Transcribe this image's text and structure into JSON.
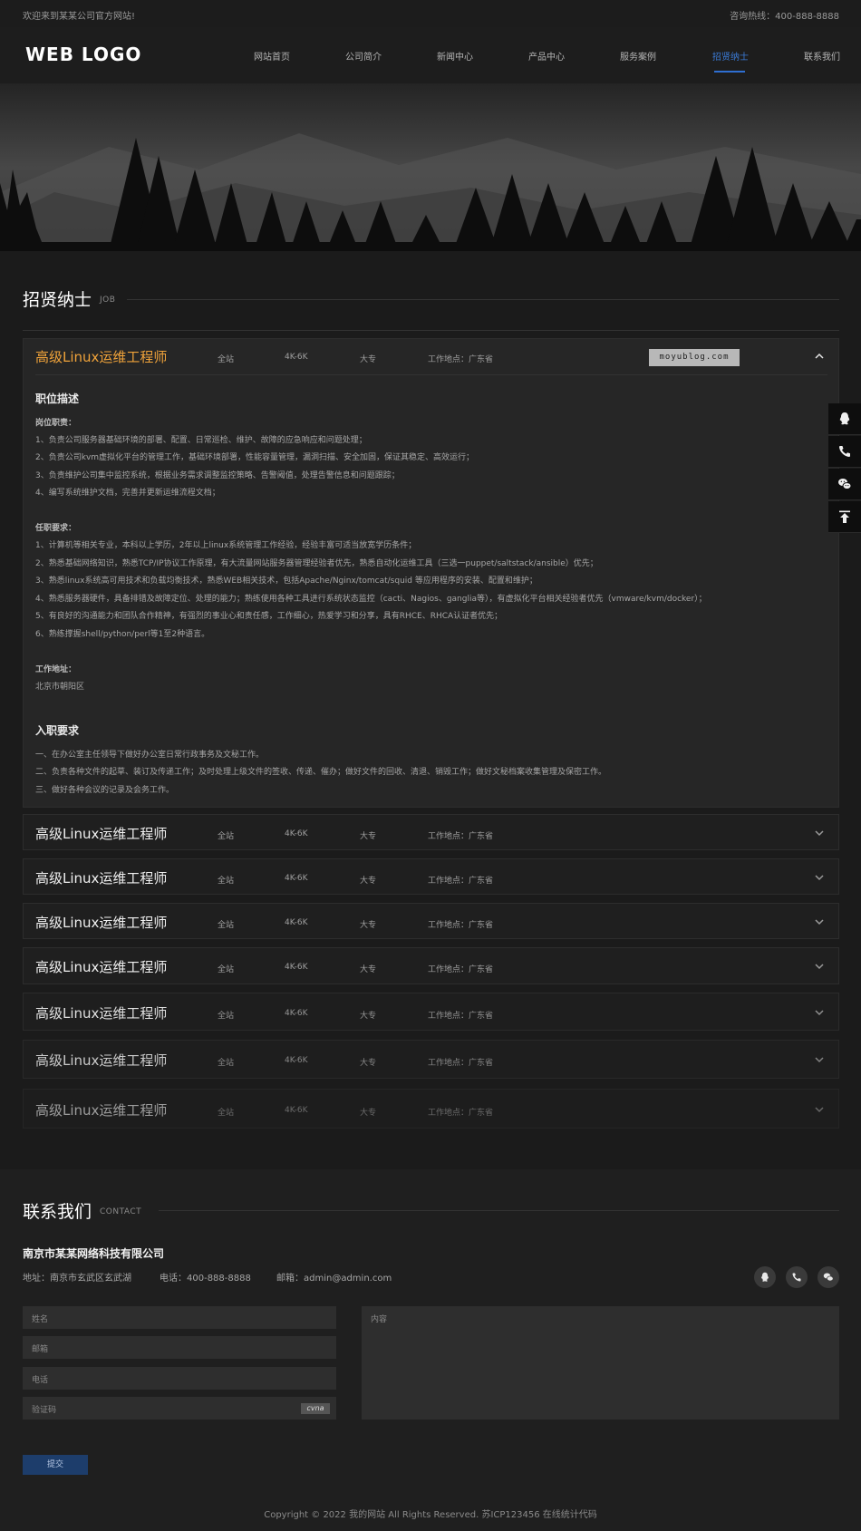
{
  "topbar": {
    "welcome": "欢迎来到某某公司官方网站!",
    "hotline": "咨询热线：400-888-8888"
  },
  "header": {
    "logo": "WEB LOGO",
    "nav": [
      {
        "label": "网站首页"
      },
      {
        "label": "公司简介"
      },
      {
        "label": "新闻中心"
      },
      {
        "label": "产品中心"
      },
      {
        "label": "服务案例"
      },
      {
        "label": "招贤纳士",
        "active": true
      },
      {
        "label": "联系我们"
      }
    ]
  },
  "jobs_section": {
    "title": "招贤纳士",
    "subtitle": "JOB"
  },
  "jobs": [
    {
      "name": "高级Linux运维工程师",
      "type": "全站",
      "salary": "4K-6K",
      "education": "大专",
      "location": "工作地点：广东省",
      "expanded": true
    },
    {
      "name": "高级Linux运维工程师",
      "type": "全站",
      "salary": "4K-6K",
      "education": "大专",
      "location": "工作地点：广东省"
    },
    {
      "name": "高级Linux运维工程师",
      "type": "全站",
      "salary": "4K-6K",
      "education": "大专",
      "location": "工作地点：广东省"
    },
    {
      "name": "高级Linux运维工程师",
      "type": "全站",
      "salary": "4K-6K",
      "education": "大专",
      "location": "工作地点：广东省"
    },
    {
      "name": "高级Linux运维工程师",
      "type": "全站",
      "salary": "4K-6K",
      "education": "大专",
      "location": "工作地点：广东省"
    },
    {
      "name": "高级Linux运维工程师",
      "type": "全站",
      "salary": "4K-6K",
      "education": "大专",
      "location": "工作地点：广东省"
    },
    {
      "name": "高级Linux运维工程师",
      "type": "全站",
      "salary": "4K-6K",
      "education": "大专",
      "location": "工作地点：广东省"
    },
    {
      "name": "高级Linux运维工程师",
      "type": "全站",
      "salary": "4K-6K",
      "education": "大专",
      "location": "工作地点：广东省"
    }
  ],
  "watermark": "moyublog.com",
  "job_detail": {
    "desc_heading": "职位描述",
    "duty_label": "岗位职责：",
    "duties": [
      "1、负责公司服务器基础环境的部署、配置、日常巡检、维护、故障的应急响应和问题处理；",
      "2、负责公司kvm虚拟化平台的管理工作，基础环境部署，性能容量管理，漏洞扫描、安全加固，保证其稳定、高效运行；",
      "3、负责维护公司集中监控系统，根据业务需求调整监控策略、告警阈值，处理告警信息和问题跟踪；",
      "4、编写系统维护文档，完善并更新运维流程文档；"
    ],
    "req_label": "任职要求：",
    "requirements": [
      "1、计算机等相关专业，本科以上学历，2年以上linux系统管理工作经验，经验丰富可适当放宽学历条件；",
      "2、熟悉基础网络知识，熟悉TCP/IP协议工作原理，有大流量网站服务器管理经验者优先，熟悉自动化运维工具（三选一puppet/saltstack/ansible）优先；",
      "3、熟悉linux系统高可用技术和负载均衡技术，熟悉WEB相关技术，包括Apache/Nginx/tomcat/squid 等应用程序的安装、配置和维护；",
      "4、熟悉服务器硬件，具备排错及故障定位、处理的能力；熟练使用各种工具进行系统状态监控（cacti、Nagios、ganglia等），有虚拟化平台相关经验者优先（vmware/kvm/docker）；",
      "5、有良好的沟通能力和团队合作精神，有强烈的事业心和责任感，工作细心，热爱学习和分享，具有RHCE、RHCA认证者优先；",
      "6、熟练撑握shell/python/perl等1至2种语言。"
    ],
    "addr_label": "工作地址：",
    "addr": "北京市朝阳区",
    "entry_heading": "入职要求",
    "entry": [
      "一、在办公室主任领导下做好办公室日常行政事务及文秘工作。",
      "二、负责各种文件的起草、装订及传递工作；及时处理上级文件的签收、传递、催办；做好文件的回收、清退、销毁工作；做好文秘档案收集管理及保密工作。",
      "三、做好各种会议的记录及会务工作。"
    ]
  },
  "contact": {
    "title": "联系我们",
    "subtitle": "CONTACT",
    "company": "南京市某某网络科技有限公司",
    "address": "地址：南京市玄武区玄武湖",
    "phone": "电话：400-888-8888",
    "email": "邮箱：admin@admin.com",
    "form": {
      "name_placeholder": "姓名",
      "email_placeholder": "邮箱",
      "phone_placeholder": "电话",
      "captcha_placeholder": "验证码",
      "captcha_text": "cvna",
      "content_placeholder": "内容",
      "submit_label": "提交"
    }
  },
  "footer": {
    "copyright": "Copyright © 2022 我的网站 All Rights Reserved. 苏ICP123456 在线统计代码"
  },
  "colors": {
    "accent": "#2f6fd1",
    "job_highlight": "#f0a33a",
    "background": "#1b1b1b"
  }
}
